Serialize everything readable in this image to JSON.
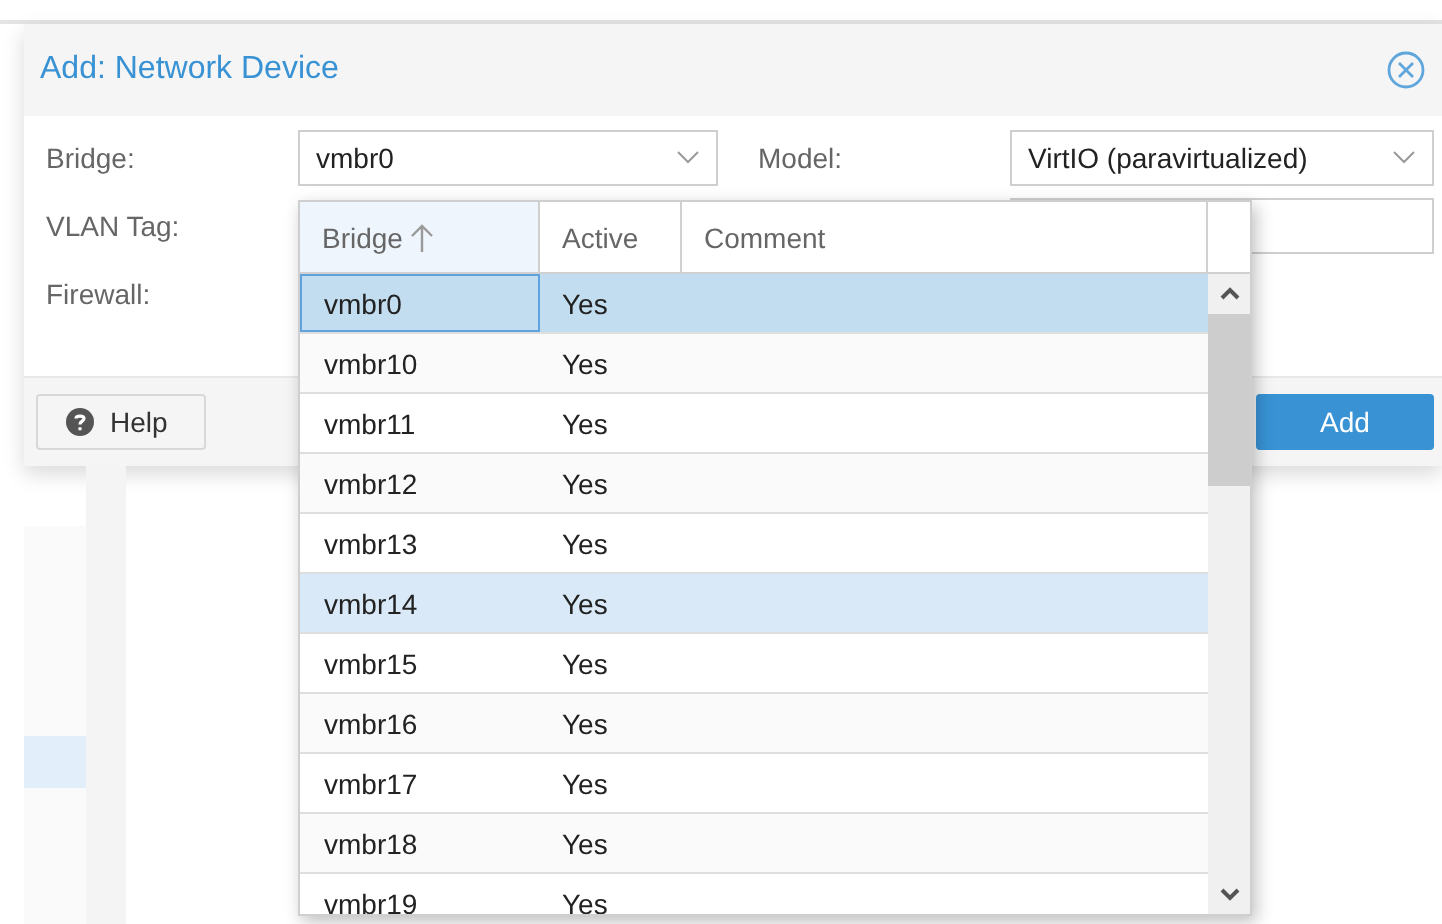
{
  "dialog": {
    "title": "Add: Network Device",
    "fields": [
      {
        "label": "Bridge:",
        "value": "vmbr0"
      },
      {
        "label": "VLAN Tag:"
      },
      {
        "label": "Firewall:"
      }
    ],
    "model": {
      "label": "Model:",
      "value": "VirtIO (paravirtualized)"
    },
    "buttons": {
      "help": "Help",
      "add": "Add"
    }
  },
  "dropdown": {
    "columns": [
      {
        "label": "Bridge",
        "sorted": true
      },
      {
        "label": "Active",
        "sorted": false
      },
      {
        "label": "Comment",
        "sorted": false
      }
    ],
    "rows": [
      {
        "bridge": "vmbr0",
        "active": "Yes",
        "selected": true,
        "hovered": false
      },
      {
        "bridge": "vmbr10",
        "active": "Yes",
        "selected": false,
        "hovered": false
      },
      {
        "bridge": "vmbr11",
        "active": "Yes",
        "selected": false,
        "hovered": false
      },
      {
        "bridge": "vmbr12",
        "active": "Yes",
        "selected": false,
        "hovered": false
      },
      {
        "bridge": "vmbr13",
        "active": "Yes",
        "selected": false,
        "hovered": false
      },
      {
        "bridge": "vmbr14",
        "active": "Yes",
        "selected": false,
        "hovered": true
      },
      {
        "bridge": "vmbr15",
        "active": "Yes",
        "selected": false,
        "hovered": false
      },
      {
        "bridge": "vmbr16",
        "active": "Yes",
        "selected": false,
        "hovered": false
      },
      {
        "bridge": "vmbr17",
        "active": "Yes",
        "selected": false,
        "hovered": false
      },
      {
        "bridge": "vmbr18",
        "active": "Yes",
        "selected": false,
        "hovered": false
      },
      {
        "bridge": "vmbr19",
        "active": "Yes",
        "selected": false,
        "hovered": false
      }
    ]
  }
}
